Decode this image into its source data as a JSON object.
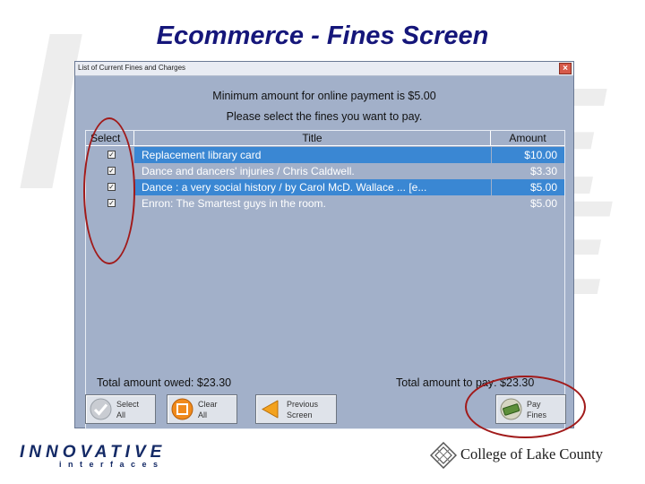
{
  "slide": {
    "title": "Ecommerce - Fines Screen",
    "watermark_letters": [
      "I",
      "E",
      "E"
    ]
  },
  "window": {
    "title": "List of Current Fines and Charges",
    "close_label": "×",
    "message_minimum": "Minimum amount for online payment is $5.00",
    "message_instruction": "Please select the fines you want to pay.",
    "columns": {
      "select": "Select",
      "title": "Title",
      "amount": "Amount"
    },
    "rows": [
      {
        "checked": true,
        "check_mark": "✓",
        "title": "Replacement library card",
        "amount": "$10.00",
        "selected": true
      },
      {
        "checked": true,
        "check_mark": "✓",
        "title": "Dance and dancers' injuries / Chris Caldwell.",
        "amount": "$3.30",
        "selected": false
      },
      {
        "checked": true,
        "check_mark": "✓",
        "title": "Dance : a very social history / by Carol McD. Wallace ... [e...",
        "amount": "$5.00",
        "selected": true
      },
      {
        "checked": true,
        "check_mark": "✓",
        "title": "Enron: The Smartest guys in the room.",
        "amount": "$5.00",
        "selected": false
      }
    ],
    "total_owed": "Total amount owed: $23.30",
    "total_to_pay": "Total amount to pay: $23.30",
    "buttons": {
      "select_all": "Select\nAll",
      "clear_all": "Clear\nAll",
      "previous_screen": "Previous\nScreen",
      "pay_fines": "Pay\nFines"
    }
  },
  "logos": {
    "innovative": "INNOVATIVE",
    "interfaces": "interfaces",
    "college": "College of Lake County"
  },
  "colors": {
    "title": "#15167a",
    "window_bg": "#a2b0c9",
    "row_selected": "#3a87d3",
    "annotation": "#a11a1a"
  }
}
